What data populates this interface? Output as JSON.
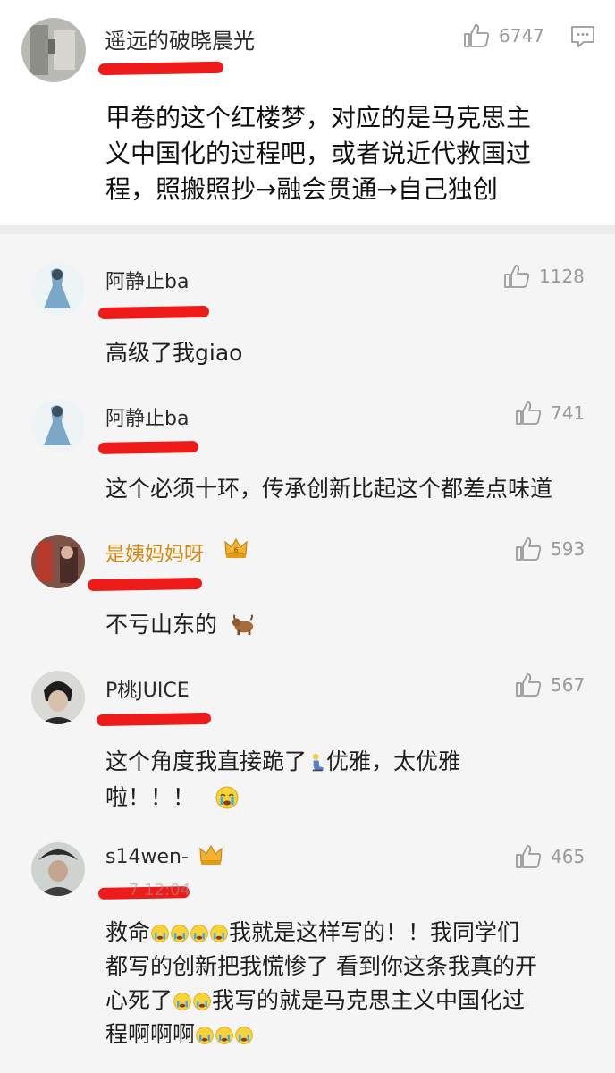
{
  "top": {
    "username": "遥远的破晓晨光",
    "likes": "6747",
    "text_lines": [
      "甲卷的这个红楼梦，对应的是马克思主",
      "义中国化的过程吧，或者说近代救国过",
      "程，照搬照抄→融会贯通→自己独创"
    ]
  },
  "replies": [
    {
      "username": "阿静止ba",
      "likes": "1128",
      "text_lines": [
        "高级了我giao"
      ]
    },
    {
      "username": "阿静止ba",
      "likes": "741",
      "text_lines": [
        "这个必须十环，传承创新比起这个都差点味道"
      ]
    },
    {
      "username": "是姨妈妈呀",
      "likes": "593",
      "text_lines": [
        "不亏山东的"
      ],
      "badge": "6"
    },
    {
      "username": "P桃JUICE",
      "likes": "567",
      "text_lines": [
        "这个角度我直接跪了",
        "优雅，太优雅",
        "啦！！！"
      ]
    },
    {
      "username": "s14wen-",
      "likes": "465",
      "text_lines": [
        "救命",
        "我就是这样写的！！我同学们",
        "都写的创新把我慌惨了 看到你这条我真的开",
        "心死了",
        "我写的就是马克思主义中国化过",
        "程啊啊啊"
      ],
      "partial_date": "7 12:04"
    }
  ],
  "colors": {
    "redaction": "#ee1b1b",
    "vip_name": "#d58b12",
    "muted": "#9a9a9a"
  },
  "icons": [
    "thumbs-up-icon",
    "comment-icon",
    "crown-badge-icon",
    "ox-emoji",
    "kneeling-emoji",
    "crying-emoji"
  ]
}
